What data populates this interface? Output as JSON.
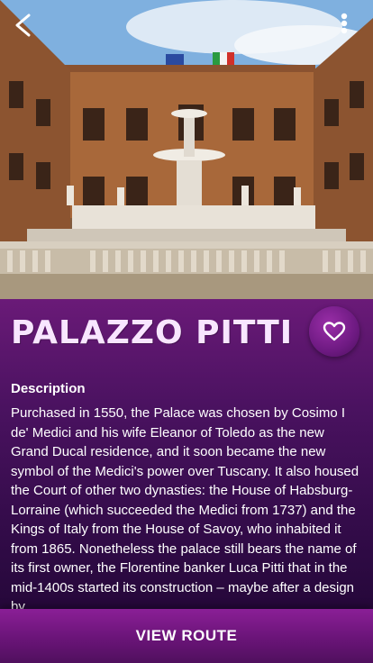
{
  "header": {
    "back_icon": "chevron-left-icon",
    "menu_icon": "more-vertical-icon"
  },
  "place": {
    "title": "PALAZZO PITTI",
    "favorite_icon": "heart-outline-icon",
    "description_heading": "Description",
    "description_text": "Purchased in 1550, the Palace was chosen by Cosimo I de' Medici and his wife Eleanor of Toledo as the new Grand Ducal residence, and it soon became the new symbol of the Medici's power over Tuscany. It also housed the Court of other two dynasties: the House of Habsburg-Lorraine (which succeeded the Medici from 1737) and the Kings of Italy from the House of Savoy, who inhabited it from 1865. Nonetheless the palace still bears the name of its first owner, the Florentine banker Luca Pitti that in the mid-1400s started its construction – maybe after a design by"
  },
  "footer": {
    "cta_label": "VIEW ROUTE"
  },
  "colors": {
    "panel_top": "#6a1a78",
    "panel_bottom": "#1e0630",
    "accent": "#8a1f96"
  }
}
